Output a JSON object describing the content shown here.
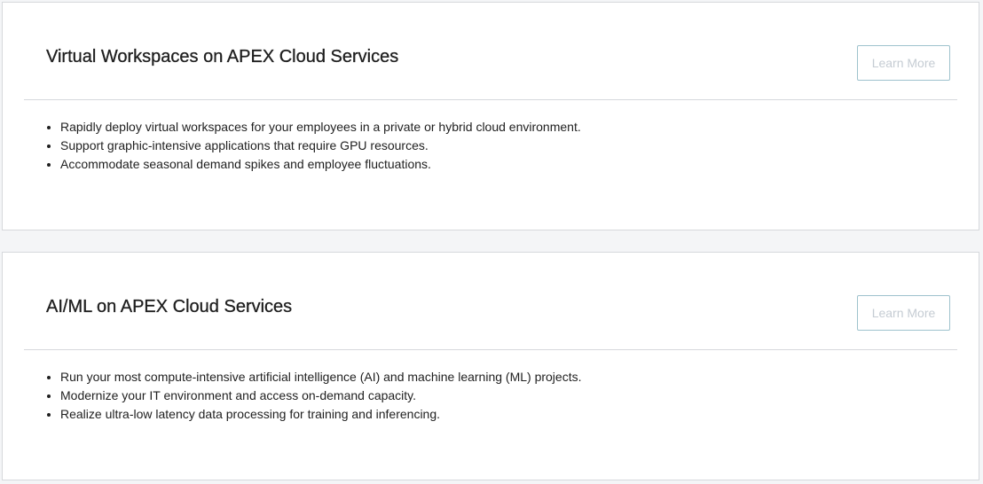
{
  "cards": [
    {
      "title": "Virtual Workspaces on APEX Cloud Services",
      "button_label": "Learn More",
      "bullets": [
        "Rapidly deploy virtual workspaces for your employees in a private or hybrid cloud environment.",
        "Support graphic-intensive applications that require GPU resources.",
        "Accommodate seasonal demand spikes and employee fluctuations."
      ]
    },
    {
      "title": "AI/ML on APEX Cloud Services",
      "button_label": "Learn More",
      "bullets": [
        "Run your most compute-intensive artificial intelligence (AI) and machine learning (ML) projects.",
        "Modernize your IT environment and access on-demand capacity.",
        "Realize ultra-low latency data processing for training and inferencing."
      ]
    }
  ],
  "colors": {
    "page_background": "#f4f5f7",
    "card_background": "#ffffff",
    "border": "#d6d8dc",
    "button_border": "#9ec2cd",
    "button_text": "#c5ccd3",
    "text": "#1f1f1f"
  }
}
